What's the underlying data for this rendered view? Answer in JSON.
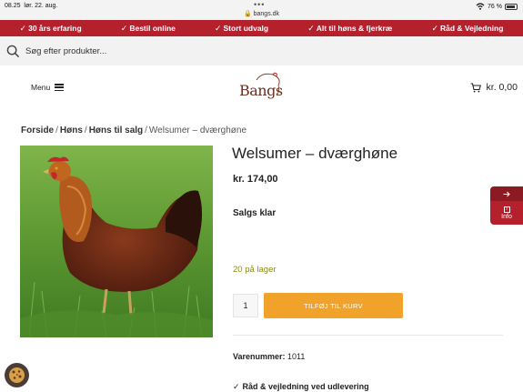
{
  "status_bar": {
    "time": "08.25",
    "date": "lør. 22. aug.",
    "url": "bangs.dk",
    "battery": "76 %"
  },
  "usp_bar": {
    "items": [
      {
        "label": "30 års erfaring"
      },
      {
        "label": "Bestil online"
      },
      {
        "label": "Stort udvalg"
      },
      {
        "label": "Alt til høns & fjerkræ"
      },
      {
        "label": "Råd & Vejledning"
      }
    ],
    "color": "#b5202d"
  },
  "search": {
    "placeholder": "Søg efter produkter..."
  },
  "header": {
    "menu_label": "Menu",
    "logo_text": "Bangs",
    "cart_total": "kr. 0,00"
  },
  "breadcrumb": {
    "items": [
      {
        "label": "Forside"
      },
      {
        "label": "Høns"
      },
      {
        "label": "Høns til salg"
      }
    ],
    "current": "Welsumer – dværghøne"
  },
  "product": {
    "title": "Welsumer – dværghøne",
    "price": "kr. 174,00",
    "status": "Salgs klar",
    "stock": "20 på lager",
    "quantity": "1",
    "add_to_cart_label": "TILFØJ TIL KURV",
    "sku_label": "Varenummer:",
    "sku_value": "1011",
    "advice": "Råd & vejledning ved udlevering",
    "accent_color": "#f0a22b",
    "stock_color": "#8b8d14"
  },
  "side_tab": {
    "label": "Info"
  }
}
